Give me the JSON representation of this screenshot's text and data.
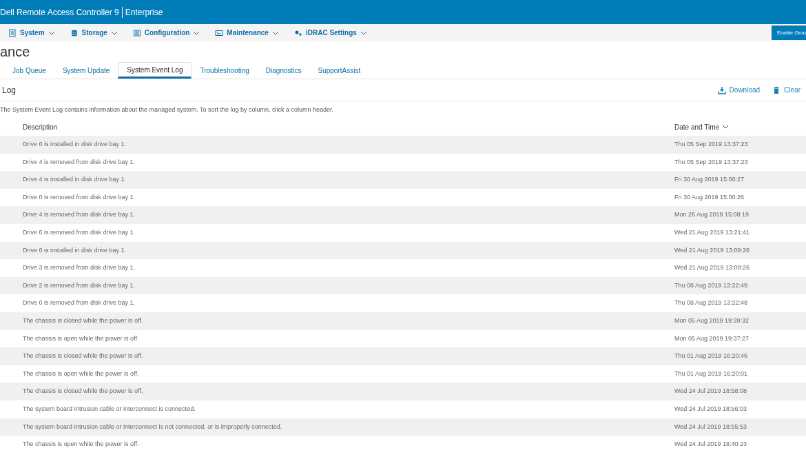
{
  "header": {
    "product": "Dell Remote Access Controller 9",
    "edition": "Enterprise"
  },
  "nav": [
    {
      "label": "System"
    },
    {
      "label": "Storage"
    },
    {
      "label": "Configuration"
    },
    {
      "label": "Maintenance"
    },
    {
      "label": "iDRAC Settings"
    }
  ],
  "nav_button": "Enable Grou",
  "page_title": "ance",
  "tabs": [
    {
      "label": "Job Queue",
      "selected": false
    },
    {
      "label": "System Update",
      "selected": false
    },
    {
      "label": "System Event Log",
      "selected": true
    },
    {
      "label": "Troubleshooting",
      "selected": false
    },
    {
      "label": "Diagnostics",
      "selected": false
    },
    {
      "label": "SupportAssist",
      "selected": false
    }
  ],
  "section_title": "Log",
  "actions": [
    {
      "label": "Download"
    },
    {
      "label": "Clear"
    }
  ],
  "info": "The System Event Log contains information about the managed system. To sort the log by column, click a column header.",
  "table": {
    "columns": [
      "Description",
      "Date and Time"
    ],
    "rows": [
      [
        "Drive 0 is installed in disk drive bay 1.",
        "Thu 05 Sep 2019 13:37:23"
      ],
      [
        "Drive 4 is removed from disk drive bay 1.",
        "Thu 05 Sep 2019 13:37:23"
      ],
      [
        "Drive 4 is installed in disk drive bay 1.",
        "Fri 30 Aug 2019 15:00:27"
      ],
      [
        "Drive 0 is removed from disk drive bay 1.",
        "Fri 30 Aug 2019 15:00:26"
      ],
      [
        "Drive 4 is removed from disk drive bay 1.",
        "Mon 26 Aug 2019 15:08:19"
      ],
      [
        "Drive 0 is removed from disk drive bay 1.",
        "Wed 21 Aug 2019 13:21:41"
      ],
      [
        "Drive 0 is installed in disk drive bay 1.",
        "Wed 21 Aug 2019 13:09:26"
      ],
      [
        "Drive 3 is removed from disk drive bay 1.",
        "Wed 21 Aug 2019 13:09:26"
      ],
      [
        "Drive 2 is removed from disk drive bay 1.",
        "Thu 08 Aug 2019 13:22:49"
      ],
      [
        "Drive 0 is removed from disk drive bay 1.",
        "Thu 08 Aug 2019 13:22:48"
      ],
      [
        "The chassis is closed while the power is off.",
        "Mon 05 Aug 2019 19:39:32"
      ],
      [
        "The chassis is open while the power is off.",
        "Mon 05 Aug 2019 19:37:27"
      ],
      [
        "The chassis is closed while the power is off.",
        "Thu 01 Aug 2019 16:20:46"
      ],
      [
        "The chassis is open while the power is off.",
        "Thu 01 Aug 2019 16:20:01"
      ],
      [
        "The chassis is closed while the power is off.",
        "Wed 24 Jul 2019 18:58:08"
      ],
      [
        "The system board Intrusion cable or interconnect is connected.",
        "Wed 24 Jul 2019 18:56:03"
      ],
      [
        "The system board Intrusion cable or interconnect is not connected, or is improperly connected.",
        "Wed 24 Jul 2019 18:55:53"
      ],
      [
        "The chassis is open while the power is off.",
        "Wed 24 Jul 2019 18:40:23"
      ]
    ]
  }
}
